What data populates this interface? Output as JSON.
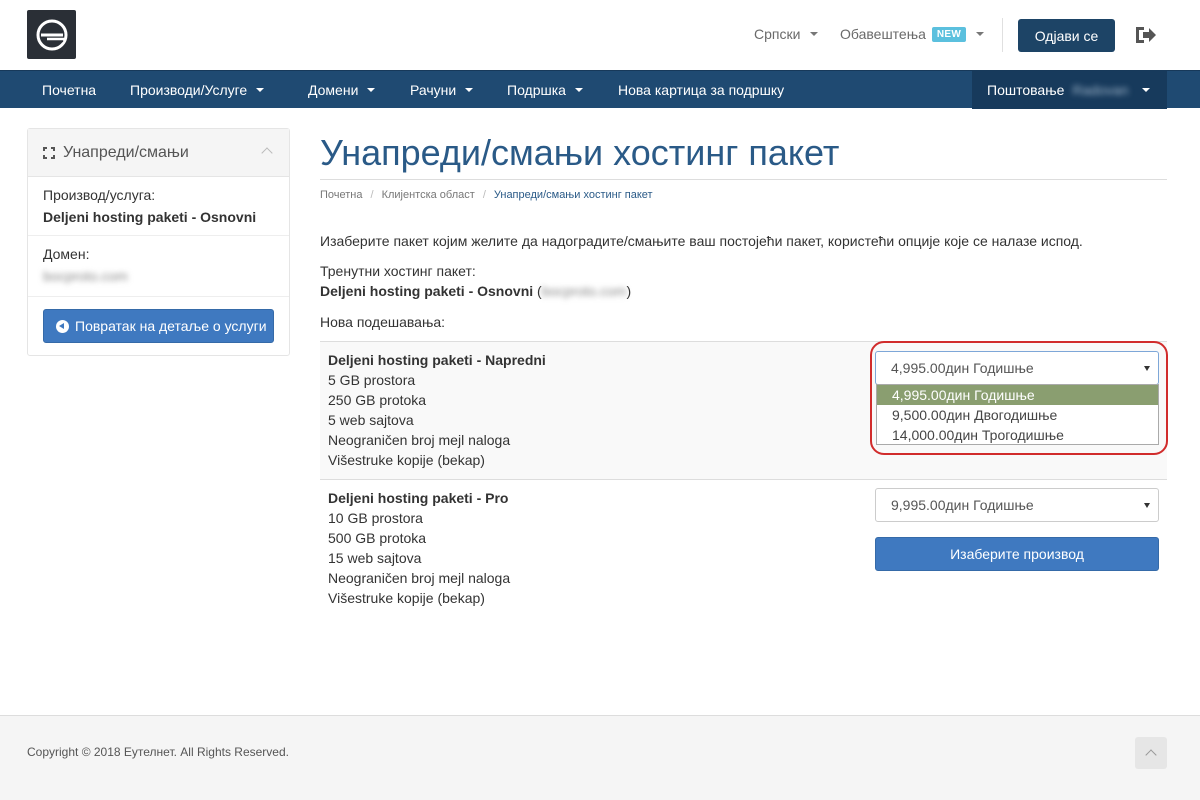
{
  "header": {
    "language": "Српски",
    "notifications": "Обавештења",
    "new_badge": "NEW",
    "logout": "Одјави се"
  },
  "nav": {
    "items": [
      {
        "label": "Почетна",
        "dropdown": false
      },
      {
        "label": "Производи/Услуге",
        "dropdown": true
      },
      {
        "label": "Домени",
        "dropdown": true
      },
      {
        "label": "Рачуни",
        "dropdown": true
      },
      {
        "label": "Подршка",
        "dropdown": true
      },
      {
        "label": "Нова картица за подршку",
        "dropdown": false
      }
    ],
    "greeting": "Поштовање",
    "username": "Radovan"
  },
  "sidebar": {
    "title": "Унапреди/смањи",
    "product_label": "Производ/услуга:",
    "product_value": "Deljeni hosting paketi - Osnovni",
    "domain_label": "Домен:",
    "domain_value": "bocproto.com",
    "back_button": "Повратак на детаље о услуги"
  },
  "main": {
    "title": "Унапреди/смањи хостинг пакет",
    "breadcrumb": [
      "Почетна",
      "Клијентска област",
      "Унапреди/смањи хостинг пакет"
    ],
    "intro": "Изаберите пакет којим желите да надоградите/смањите ваш постојећи пакет, користећи опције које се налазе испод.",
    "current_label": "Тренутни хостинг пакет:",
    "current_value": "Deljeni hosting paketi - Osnovni",
    "current_domain": "bocproto.com",
    "new_label": "Нова подешавања:",
    "packages": [
      {
        "name": "Deljeni hosting paketi - Napredni",
        "features": [
          "5 GB prostora",
          "250 GB protoka",
          "5 web sajtova",
          "Neograničen broj mejl naloga",
          "Višestruke kopije (bekap)"
        ],
        "selected_option": "4,995.00дин Годишње",
        "options": [
          "4,995.00дин Годишње",
          "9,500.00дин Двогодишње",
          "14,000.00дин Трогодишње"
        ]
      },
      {
        "name": "Deljeni hosting paketi - Pro",
        "features": [
          "10 GB prostora",
          "500 GB protoka",
          "15 web sajtova",
          "Neograničen broj mejl naloga",
          "Višestruke kopije (bekap)"
        ],
        "selected_option": "9,995.00дин Годишње",
        "choose_button": "Изаберите производ"
      }
    ]
  },
  "footer": {
    "copyright": "Copyright © 2018 Еутелнет. All Rights Reserved."
  },
  "colors": {
    "primary": "#3f79c0",
    "navbar": "#1f4a72",
    "title": "#2a5a87",
    "highlight_ring": "#d12c2c",
    "selected_option_bg": "#8a9e70"
  }
}
